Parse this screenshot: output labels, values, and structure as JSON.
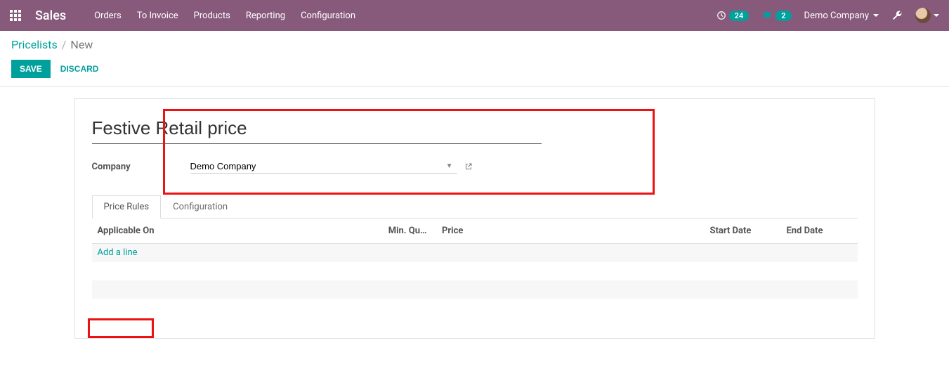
{
  "nav": {
    "brand": "Sales",
    "items": [
      "Orders",
      "To Invoice",
      "Products",
      "Reporting",
      "Configuration"
    ],
    "activity_count": "24",
    "messages_count": "2",
    "company": "Demo Company"
  },
  "breadcrumb": {
    "parent": "Pricelists",
    "current": "New"
  },
  "buttons": {
    "save": "SAVE",
    "discard": "DISCARD"
  },
  "form": {
    "title_value": "Festive Retail price",
    "company_label": "Company",
    "company_value": "Demo Company"
  },
  "tabs": {
    "price_rules": "Price Rules",
    "configuration": "Configuration"
  },
  "table": {
    "headers": {
      "applicable_on": "Applicable On",
      "min_qty": "Min. Qu…",
      "price": "Price",
      "start_date": "Start Date",
      "end_date": "End Date"
    },
    "add_line": "Add a line"
  }
}
